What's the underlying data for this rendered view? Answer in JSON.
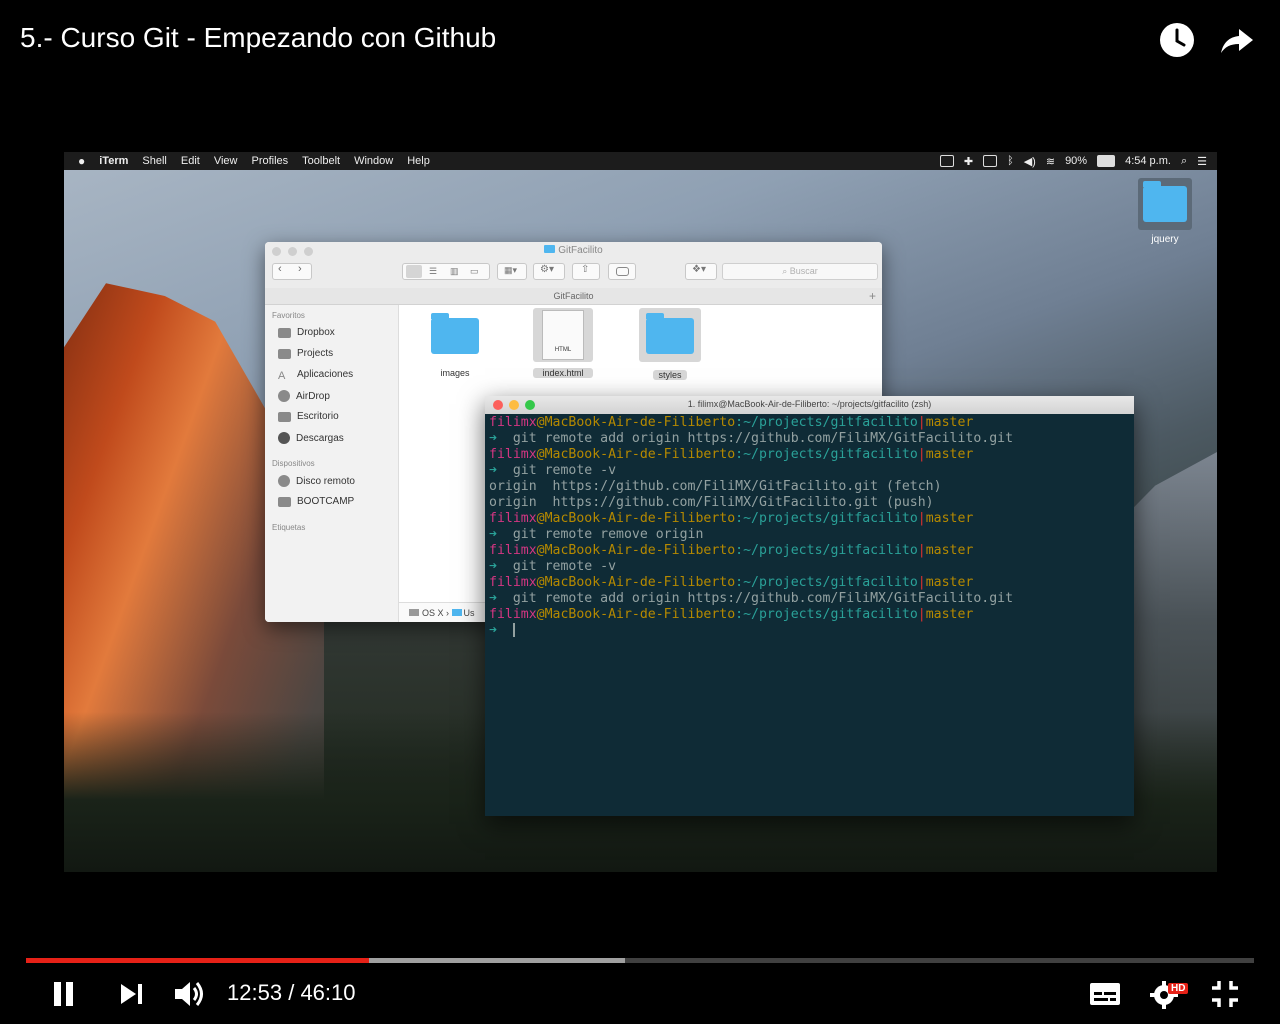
{
  "player": {
    "title": "5.- Curso Git - Empezando con Github",
    "current_time": "12:53",
    "separator": "/",
    "duration": "46:10",
    "played_fraction": 0.279,
    "buffered_fraction": 0.488,
    "hd_badge": "HD",
    "icons": [
      "watch-later-icon",
      "share-icon",
      "pause-icon",
      "next-icon",
      "volume-icon",
      "subtitles-icon",
      "settings-icon",
      "exit-fullscreen-icon"
    ]
  },
  "menubar": {
    "apple": "",
    "app": "iTerm",
    "items": [
      "Shell",
      "Edit",
      "View",
      "Profiles",
      "Toolbelt",
      "Window",
      "Help"
    ],
    "battery": "90%",
    "clock": "4:54 p.m."
  },
  "desktop": {
    "folder_label": "jquery"
  },
  "finder": {
    "title": "GitFacilito",
    "path_title": "GitFacilito",
    "search_placeholder": "Buscar",
    "sections": {
      "favoritos": "Favoritos",
      "dispositivos": "Dispositivos",
      "etiquetas": "Etiquetas"
    },
    "favorites": [
      "Dropbox",
      "Projects",
      "Aplicaciones",
      "AirDrop",
      "Escritorio",
      "Descargas"
    ],
    "devices": [
      "Disco remoto",
      "BOOTCAMP"
    ],
    "files": [
      {
        "name": "images",
        "kind": "folder"
      },
      {
        "name": "index.html",
        "kind": "html"
      },
      {
        "name": "styles",
        "kind": "folder"
      }
    ],
    "html_label": "HTML",
    "bottom_path_1": "OS X",
    "bottom_path_2": "Us"
  },
  "terminal": {
    "title": "1. filimx@MacBook-Air-de-Filiberto: ~/projects/gitfacilito (zsh)",
    "user": "filimx",
    "at": "@",
    "host": "MacBook-Air-de-Filiberto",
    "colon": ":",
    "path": "~/projects/gitfacilito",
    "bar": "|",
    "branch": "master",
    "arrow": "➜",
    "cmd1": "  git remote add origin https://github.com/FiliMX/GitFacilito.git",
    "cmd2": "  git remote -v",
    "out1": "origin  https://github.com/FiliMX/GitFacilito.git (fetch)",
    "out2": "origin  https://github.com/FiliMX/GitFacilito.git (push)",
    "cmd3": "  git remote remove origin",
    "cmd4": "  git remote -v",
    "cmd5": "  git remote add origin https://github.com/FiliMX/GitFacilito.git"
  },
  "colors": {
    "progress": "#e62117",
    "terminal_bg": "#0f2b36",
    "prompt_user": "#d33682",
    "prompt_host": "#b58900",
    "prompt_path": "#2aa198",
    "folder": "#4fb6ef"
  }
}
